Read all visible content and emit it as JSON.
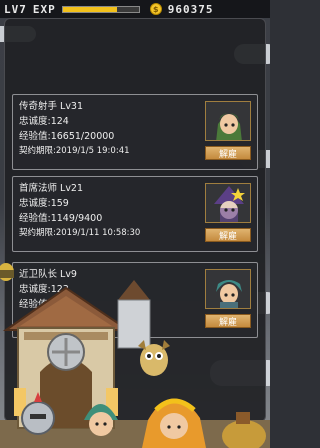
{
  "hud": {
    "level_label": "LV7",
    "exp_label": "EXP",
    "exp_progress": 0.72,
    "coin_symbol": "$",
    "gold": "960375"
  },
  "heroes": [
    {
      "name_line": "传奇射手 Lv31",
      "loyalty": "忠诚度:124",
      "exp": "经验值:16651/20000",
      "contract": "契约期限:2019/1/5 19:0:41",
      "button": "解雇",
      "portrait": "archer-portrait-icon",
      "portrait_color": "#4b7a3a"
    },
    {
      "name_line": "首席法师 Lv21",
      "loyalty": "忠诚度:159",
      "exp": "经验值:1149/9400",
      "contract": "契约期限:2019/1/11 10:58:30",
      "button": "解雇",
      "portrait": "mage-portrait-icon",
      "portrait_color": "#5b3f86"
    },
    {
      "name_line": "近卫队长 Lv9",
      "loyalty": "忠诚度:123",
      "exp": "经验值:",
      "contract": "",
      "button": "解雇",
      "portrait": "captain-portrait-icon",
      "portrait_color": "#3d8a86"
    }
  ],
  "colors": {
    "gold": "#f3c11b",
    "button": "#d9a55a",
    "panel": "#202125"
  }
}
